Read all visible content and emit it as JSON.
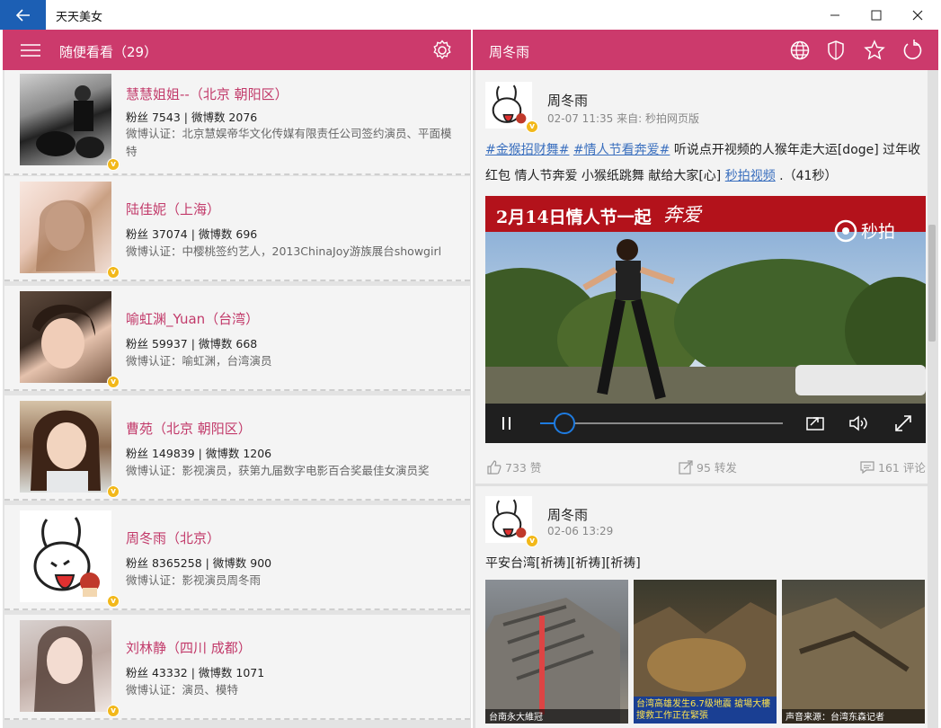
{
  "window": {
    "title": "天天美女"
  },
  "left_header": {
    "title": "随便看看（29）"
  },
  "right_header": {
    "title": "周冬雨"
  },
  "users": [
    {
      "name": "慧慧姐姐--（北京 朝阳区）",
      "stats": "粉丝 7543 | 微博数 2076",
      "desc": "微博认证：北京慧娱帝华文化传媒有限责任公司签约演员、平面模特"
    },
    {
      "name": "陆佳妮（上海）",
      "stats": "粉丝 37074 | 微博数 696",
      "desc": "微博认证：中樱桃签约艺人，2013ChinaJoy游族展台showgirl"
    },
    {
      "name": "喻虹渊_Yuan（台湾）",
      "stats": "粉丝 59937 | 微博数 668",
      "desc": "微博认证：喻虹渊，台湾演员"
    },
    {
      "name": "曹苑（北京 朝阳区）",
      "stats": "粉丝 149839 | 微博数 1206",
      "desc": "微博认证：影视演员，获第九届数字电影百合奖最佳女演员奖"
    },
    {
      "name": "周冬雨（北京）",
      "stats": "粉丝 8365258 | 微博数 900",
      "desc": "微博认证：影视演员周冬雨"
    },
    {
      "name": "刘林静（四川 成都）",
      "stats": "粉丝 43332 | 微博数 1071",
      "desc": "微博认证：演员、模特"
    }
  ],
  "badge_glyph": "v",
  "posts": [
    {
      "author": "周冬雨",
      "meta": "02-07 11:35  来自: 秒拍网页版",
      "tag1": "#金猴招财舞#",
      "tag2": "#情人节看奔爱#",
      "text1": " 听说点开视频的人猴年走大运[doge] 过年收红包 情人节奔爱 小猴纸跳舞 献给大家[心] ",
      "link": "秒拍视频",
      "text2": " .（41秒）",
      "video_banner": "2月14日情人节一起",
      "video_banner_script": "奔爱",
      "video_watermark": "秒拍",
      "progress": 0.1,
      "likes": "733 赞",
      "reposts": "95 转发",
      "comments": "161 评论"
    },
    {
      "author": "周冬雨",
      "meta": "02-06 13:29",
      "text": "平安台湾[祈祷][祈祷][祈祷]",
      "thumb_captions": [
        "台南永大維冠",
        "台湾高雄发生6.7级地震 搶場大樓搜救工作正在緊張",
        "声音来源：台湾东森记者"
      ]
    }
  ],
  "colors": {
    "accent": "#cc3a6c",
    "name_pink": "#c23a6a",
    "badge": "#f2b81a",
    "link": "#3a6fbe",
    "back": "#1c5fb4"
  }
}
